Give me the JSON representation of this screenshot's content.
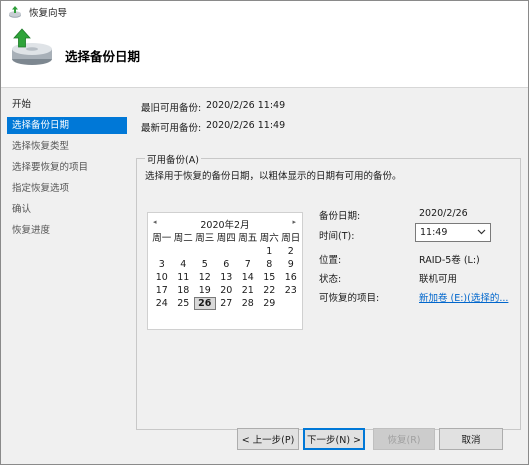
{
  "window": {
    "title": "恢复向导",
    "icons": {
      "title": "recovery-wizard-icon",
      "header": "backup-disk-restore-icon"
    }
  },
  "header": {
    "title": "选择备份日期"
  },
  "nav": {
    "items": [
      {
        "label": "开始",
        "active": false
      },
      {
        "label": "选择备份日期",
        "active": true
      },
      {
        "label": "选择恢复类型",
        "active": false
      },
      {
        "label": "选择要恢复的项目",
        "active": false
      },
      {
        "label": "指定恢复选项",
        "active": false
      },
      {
        "label": "确认",
        "active": false
      },
      {
        "label": "恢复进度",
        "active": false
      }
    ]
  },
  "info": {
    "oldest_label": "最旧可用备份:",
    "oldest_value": "2020/2/26 11:49",
    "newest_label": "最新可用备份:",
    "newest_value": "2020/2/26 11:49"
  },
  "available": {
    "group_label": "可用备份(A)",
    "description": "选择用于恢复的备份日期，以粗体显示的日期有可用的备份。"
  },
  "calendar": {
    "prev_icon": "◂",
    "next_icon": "▸",
    "month_label": "2020年2月",
    "weekdays": [
      "周一",
      "周二",
      "周三",
      "周四",
      "周五",
      "周六",
      "周日"
    ],
    "weeks": [
      [
        "",
        "",
        "",
        "",
        "",
        "1",
        "2"
      ],
      [
        "3",
        "4",
        "5",
        "6",
        "7",
        "8",
        "9"
      ],
      [
        "10",
        "11",
        "12",
        "13",
        "14",
        "15",
        "16"
      ],
      [
        "17",
        "18",
        "19",
        "20",
        "21",
        "22",
        "23"
      ],
      [
        "24",
        "25",
        "26",
        "27",
        "28",
        "29",
        ""
      ]
    ],
    "selected_day": "26",
    "bold_days": [
      "26"
    ]
  },
  "details": {
    "backup_date_label": "备份日期:",
    "backup_date_value": "2020/2/26",
    "time_label": "时间(T):",
    "time_value": "11:49",
    "location_label": "位置:",
    "location_value": "RAID-5卷 (L:)",
    "status_label": "状态:",
    "status_value": "联机可用",
    "items_label": "可恢复的项目:",
    "items_value": "新加卷 (E:)(选择的..."
  },
  "buttons": {
    "back": "< 上一步(P)",
    "next": "下一步(N) >",
    "recover": "恢复(R)",
    "cancel": "取消"
  },
  "colors": {
    "accent": "#0078d7",
    "link": "#0066cc",
    "nav_active_text": "#ffffff"
  }
}
